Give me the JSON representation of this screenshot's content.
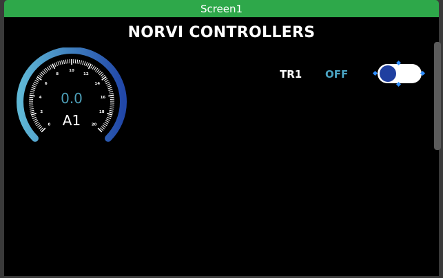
{
  "window": {
    "title": "Screen1"
  },
  "screen": {
    "heading": "NORVI CONTROLLERS"
  },
  "gauge": {
    "value": "0.0",
    "label": "A1",
    "min": 0,
    "max": 20,
    "current": 0.0,
    "tick_labels": [
      "0",
      "2",
      "4",
      "6",
      "8",
      "10",
      "12",
      "14",
      "16",
      "18",
      "20"
    ],
    "colors": {
      "arc_start": "#5fb8d6",
      "arc_end": "#2147a8",
      "value_text": "#4d9fb8"
    }
  },
  "relay": {
    "label": "TR1",
    "state": "OFF",
    "toggle_on": false,
    "colors": {
      "state_text": "#4aa3c2",
      "knob": "#1f3fa0",
      "track": "#ffffff"
    }
  },
  "colors": {
    "titlebar": "#2ea84a",
    "screen_bg": "#000000",
    "selection_handle": "#2f8fff"
  }
}
